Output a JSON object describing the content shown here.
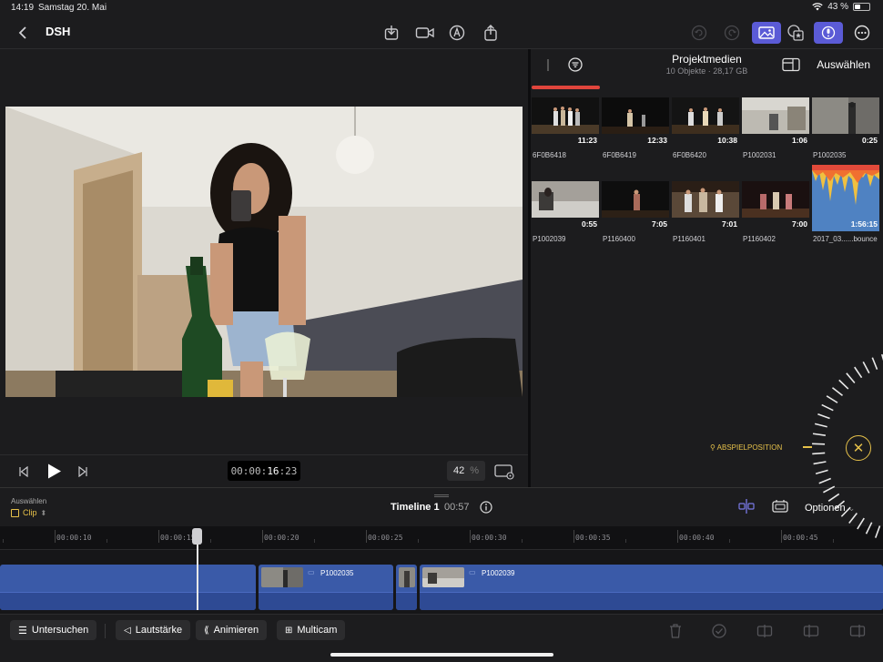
{
  "status": {
    "time": "14:19",
    "date": "Samstag 20. Mai",
    "battery": "43 %"
  },
  "toolbar": {
    "back_icon": "chevron-left-icon",
    "project_title": "DSH",
    "accent": "#5b5bd6"
  },
  "viewer": {
    "timecode": {
      "prefix": "00:00:",
      "seconds": "16",
      "frames": ":23"
    },
    "zoom_value": "42",
    "zoom_unit": "%"
  },
  "browser": {
    "title": "Projektmedien",
    "subtitle": "10 Objekte  ·  28,17 GB",
    "select_label": "Auswählen",
    "clips": [
      {
        "name": "6F0B6418",
        "duration": "11:23"
      },
      {
        "name": "6F0B6419",
        "duration": "12:33"
      },
      {
        "name": "6F0B6420",
        "duration": "10:38"
      },
      {
        "name": "P1002031",
        "duration": "1:06"
      },
      {
        "name": "P1002035",
        "duration": "0:25"
      },
      {
        "name": "P1002039",
        "duration": "0:55"
      },
      {
        "name": "P1160400",
        "duration": "7:05"
      },
      {
        "name": "P1160401",
        "duration": "7:01"
      },
      {
        "name": "P1160402",
        "duration": "7:00"
      },
      {
        "name": "2017_03......bounce",
        "duration": "1:56:15"
      }
    ],
    "playhead_label": "ABSPIELPOSITION",
    "playhead_color": "#e6c14a"
  },
  "timeline": {
    "select_label": "Auswählen",
    "clip_mode": "Clip",
    "title": "Timeline 1",
    "duration": "00:57",
    "options_label": "Optionen",
    "ruler": [
      "00:00:10",
      "00:00:15",
      "00:00:20",
      "00:00:25",
      "00:00:30",
      "00:00:35",
      "00:00:40",
      "00:00:45"
    ],
    "clips": [
      {
        "name": ""
      },
      {
        "name": "P1002035"
      },
      {
        "name": ""
      },
      {
        "name": "P1002039"
      }
    ],
    "clip_color": "#3a5aa8"
  },
  "bottom": {
    "inspect": "Untersuchen",
    "volume": "Lautstärke",
    "animate": "Animieren",
    "multicam": "Multicam"
  }
}
